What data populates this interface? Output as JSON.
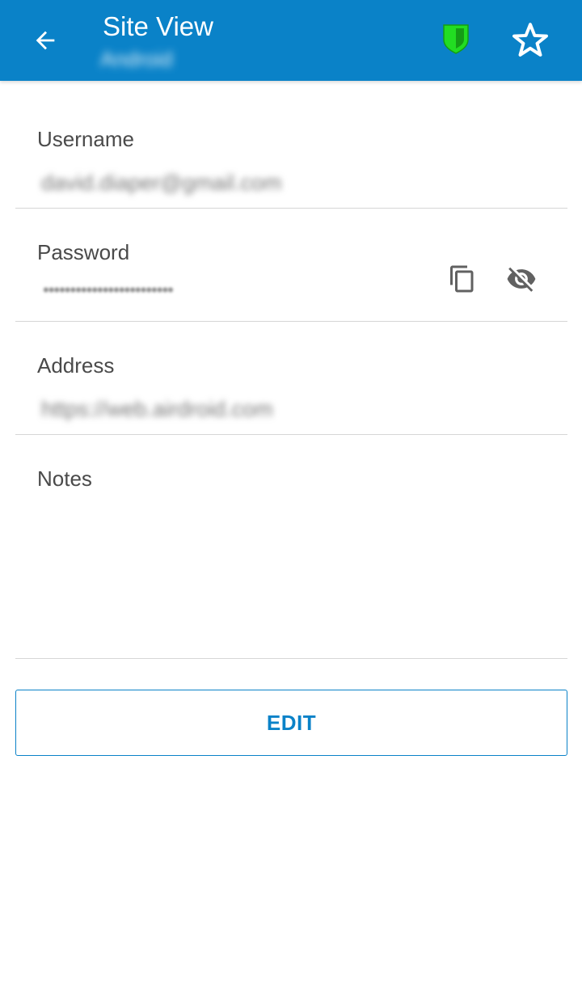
{
  "appbar": {
    "title": "Site View",
    "subtitle": "Android",
    "back_icon": "arrow-left-icon",
    "shield_icon": "shield-icon",
    "star_icon": "star-outline-icon",
    "background_color": "#0a82c8",
    "shield_color": "#22dd22"
  },
  "fields": {
    "username": {
      "label": "Username",
      "value": "david.diaper@gmail.com"
    },
    "password": {
      "label": "Password",
      "value": "••••••••••••••••••••••••",
      "copy_icon": "copy-icon",
      "visibility_icon": "eye-off-icon"
    },
    "address": {
      "label": "Address",
      "value": "https://web.airdroid.com"
    },
    "notes": {
      "label": "Notes",
      "value": ""
    }
  },
  "actions": {
    "edit_label": "EDIT"
  }
}
